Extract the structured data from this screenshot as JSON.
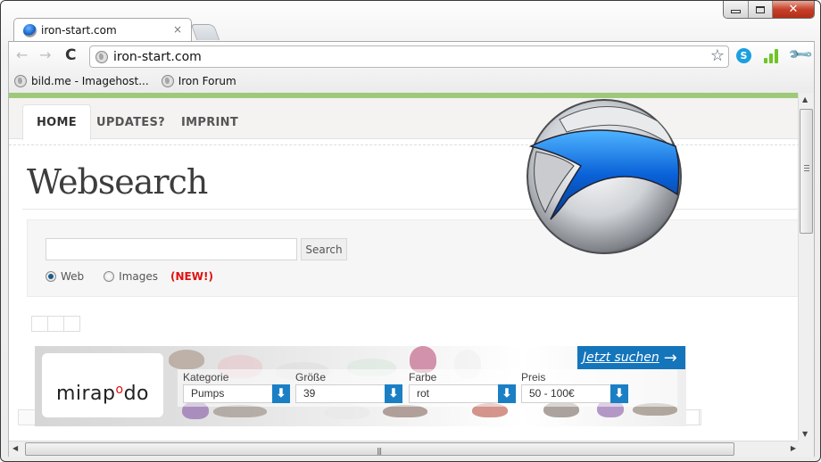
{
  "window": {
    "controls": {
      "minimize": "minimize",
      "maximize": "maximize",
      "close": "✕"
    }
  },
  "tabs": [
    {
      "title": "iron-start.com",
      "close": "×",
      "active": true
    }
  ],
  "toolbar": {
    "back": "←",
    "forward": "→",
    "reload": "C",
    "url": "iron-start.com",
    "bookmark_star": "☆",
    "skype_ext": "S",
    "wrench": "🔧"
  },
  "bookmarks": [
    {
      "label": "bild.me - Imagehost..."
    },
    {
      "label": "Iron Forum"
    }
  ],
  "page": {
    "accent_color": "#9ec97a",
    "nav": [
      {
        "label": "HOME",
        "active": true
      },
      {
        "label": "UPDATES?",
        "active": false
      },
      {
        "label": "IMPRINT",
        "active": false
      }
    ],
    "title": "Websearch",
    "search": {
      "value": "",
      "button": "Search",
      "options": [
        {
          "label": "Web",
          "checked": true
        },
        {
          "label": "Images",
          "checked": false
        }
      ],
      "new_badge": "(NEW!)"
    },
    "ad": {
      "brand_prefix": "mirap",
      "brand_o": "o",
      "brand_suffix": "do",
      "cta": "Jetzt suchen",
      "cta_arrow": "→",
      "fields": [
        {
          "label": "Kategorie",
          "value": "Pumps"
        },
        {
          "label": "Größe",
          "value": "39"
        },
        {
          "label": "Farbe",
          "value": "rot"
        },
        {
          "label": "Preis",
          "value": "50 - 100€"
        }
      ],
      "cta_color": "#1575bb"
    }
  },
  "scrollbars": {
    "up": "▲",
    "down": "▼",
    "left": "◀",
    "right": "▶",
    "grip": "|||"
  }
}
